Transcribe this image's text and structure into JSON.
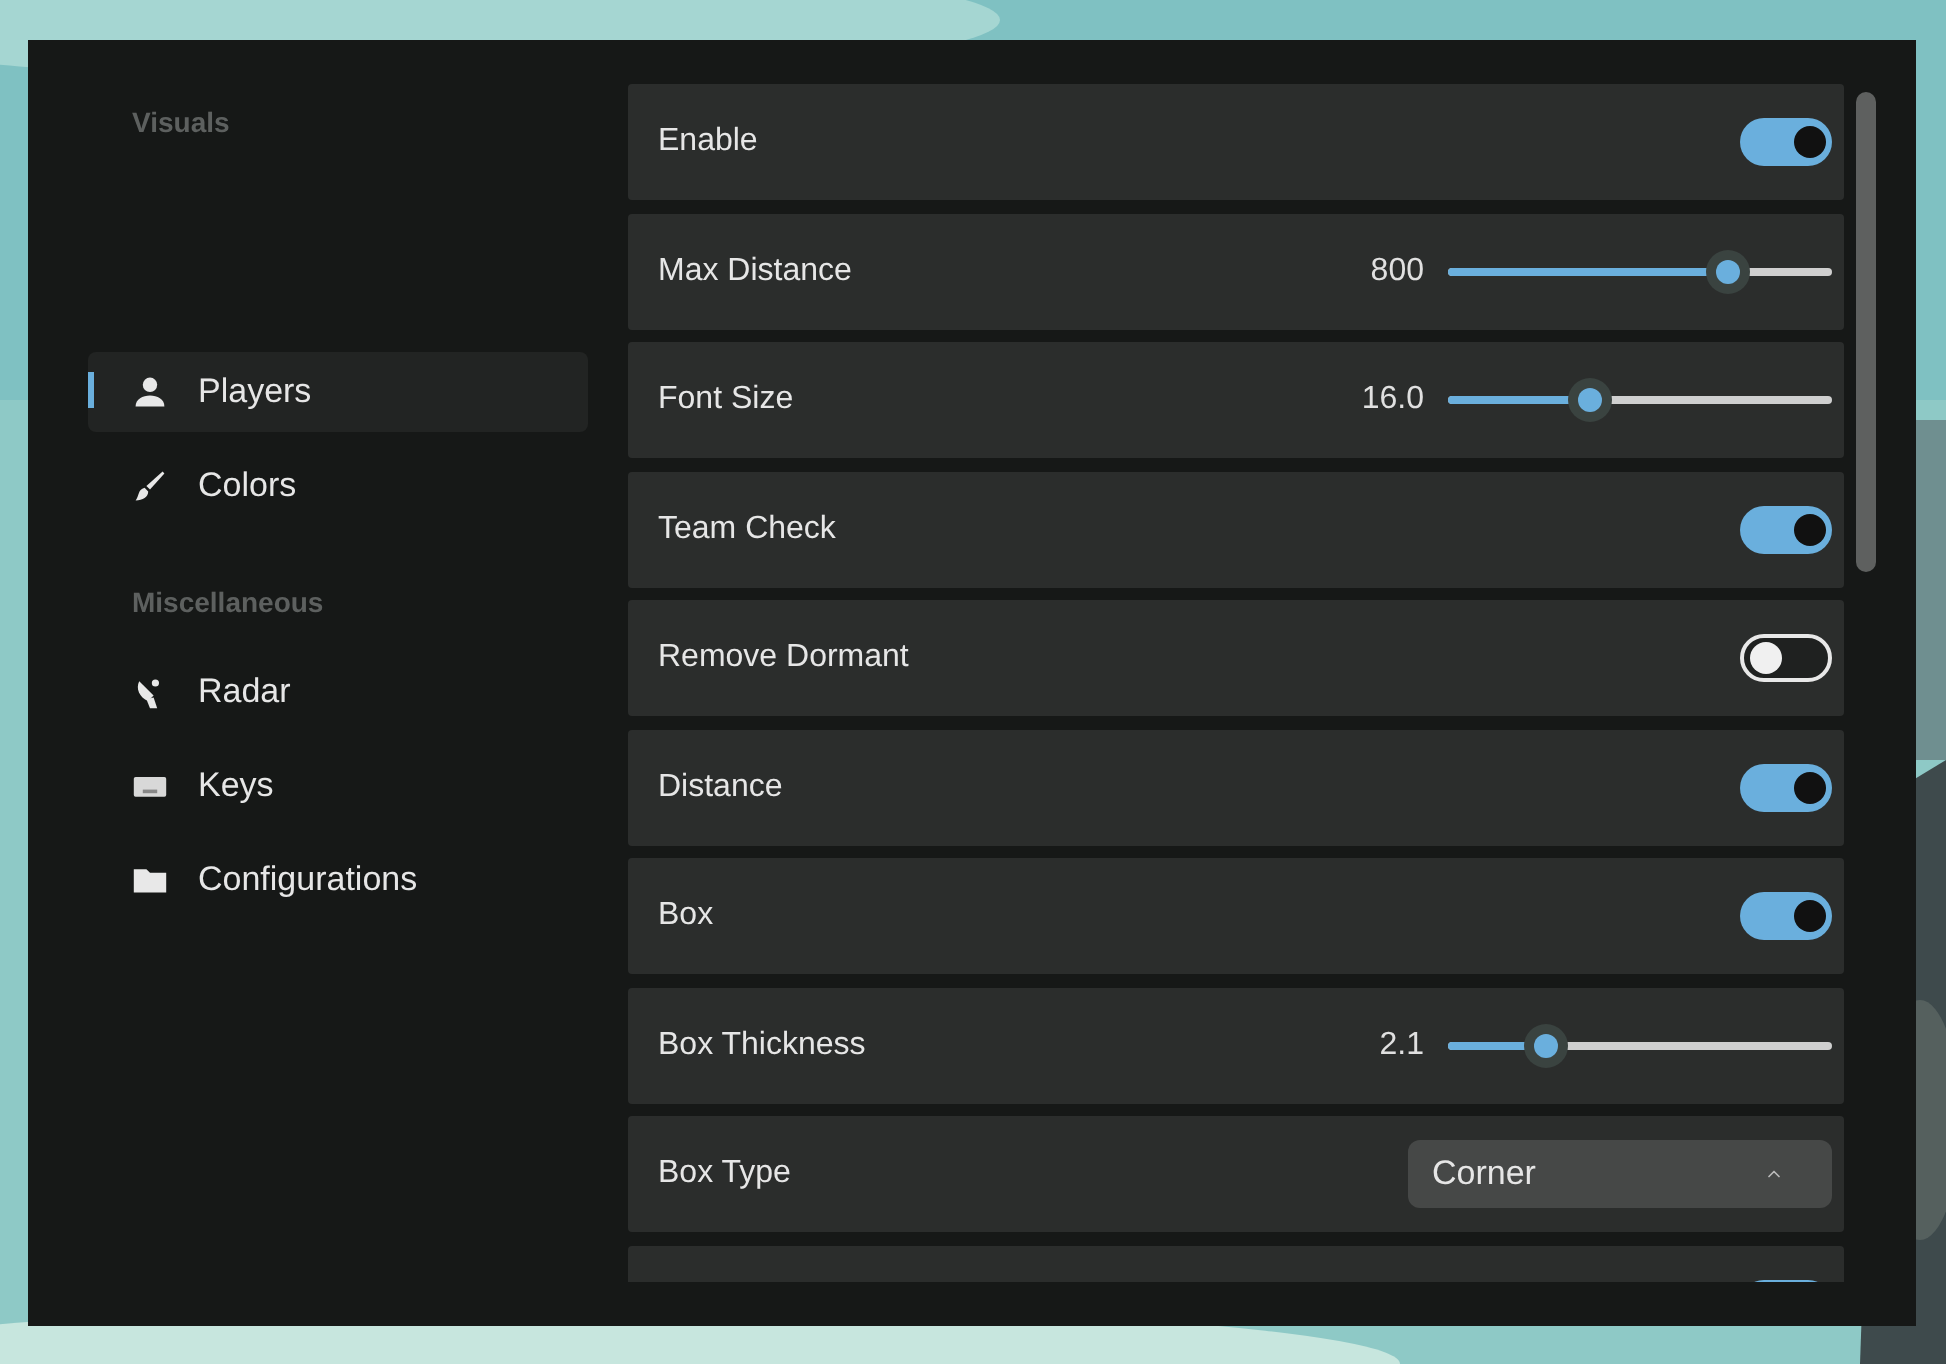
{
  "sidebar": {
    "sections": [
      {
        "header": "Visuals",
        "items": [
          {
            "label": "Players",
            "selected": true
          },
          {
            "label": "Colors",
            "selected": false
          }
        ]
      },
      {
        "header": "Miscellaneous",
        "items": [
          {
            "label": "Radar",
            "selected": false
          },
          {
            "label": "Keys",
            "selected": false
          },
          {
            "label": "Configurations",
            "selected": false
          }
        ]
      }
    ]
  },
  "settings": [
    {
      "kind": "toggle",
      "label": "Enable",
      "on": true
    },
    {
      "kind": "slider",
      "label": "Max Distance",
      "reading": "800",
      "level": 0.73
    },
    {
      "kind": "slider",
      "label": "Font Size",
      "reading": "16.0",
      "level": 0.37
    },
    {
      "kind": "toggle",
      "label": "Team Check",
      "on": true
    },
    {
      "kind": "toggle",
      "label": "Remove Dormant",
      "on": false
    },
    {
      "kind": "toggle",
      "label": "Distance",
      "on": true
    },
    {
      "kind": "toggle",
      "label": "Box",
      "on": true
    },
    {
      "kind": "slider",
      "label": "Box Thickness",
      "reading": "2.1",
      "level": 0.255
    },
    {
      "kind": "dropdown",
      "label": "Box Type",
      "value": "Corner"
    },
    {
      "kind": "toggle",
      "on": true
    }
  ]
}
